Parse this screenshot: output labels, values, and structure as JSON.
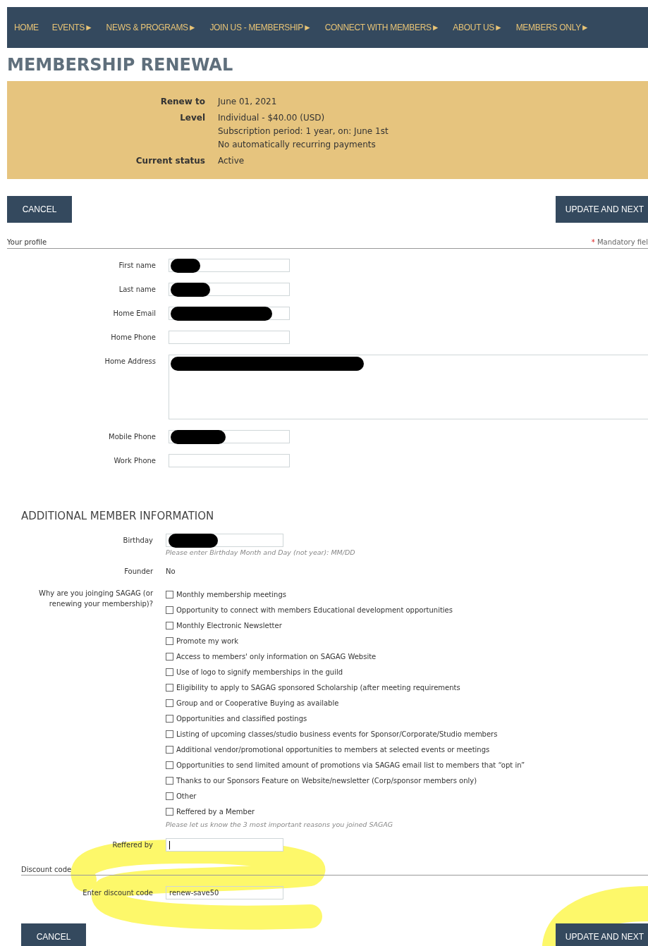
{
  "nav": {
    "items": [
      {
        "label": "HOME"
      },
      {
        "label": "EVENTS",
        "arrow": "►"
      },
      {
        "label": "NEWS & PROGRAMS",
        "arrow": "►"
      },
      {
        "label": "JOIN US - MEMBERSHIP",
        "arrow": "►"
      },
      {
        "label": "CONNECT WITH MEMBERS",
        "arrow": "►"
      },
      {
        "label": "ABOUT US",
        "arrow": "►"
      },
      {
        "label": "MEMBERS ONLY",
        "arrow": "►"
      }
    ]
  },
  "title": "MEMBERSHIP RENEWAL",
  "summary": [
    {
      "label": "Renew to",
      "lines": [
        "June 01, 2021"
      ]
    },
    {
      "label": "Level",
      "lines": [
        "Individual - $40.00 (USD)",
        "Subscription period: 1 year, on: June 1st",
        "No automatically recurring payments"
      ]
    },
    {
      "label": "Current status",
      "lines": [
        "Active"
      ]
    }
  ],
  "buttons_top": {
    "cancel": "CANCEL",
    "next": "UPDATE AND NEXT"
  },
  "profile": {
    "heading": "Your profile",
    "mandatory_mark": "*",
    "mandatory": "Mandatory fiel",
    "fields": [
      {
        "label": "First name",
        "kind": "input",
        "redacted": true
      },
      {
        "label": "Last name",
        "kind": "input",
        "redacted": true
      },
      {
        "label": "Home Email",
        "kind": "input",
        "redacted": true
      },
      {
        "label": "Home Phone",
        "kind": "input",
        "redacted": false
      },
      {
        "label": "Home Address",
        "kind": "textarea",
        "redacted": true
      },
      {
        "label": "Mobile Phone",
        "kind": "input",
        "redacted": true
      },
      {
        "label": "Work Phone",
        "kind": "input",
        "redacted": false
      }
    ]
  },
  "additional": {
    "heading": "ADDITIONAL MEMBER INFORMATION",
    "birthday": {
      "label": "Birthday",
      "redacted": true,
      "hint": "Please enter Birthday Month and Day (not year): MM/DD"
    },
    "founder": {
      "label": "Founder",
      "value": "No"
    },
    "reasons": {
      "label": "Why are you joinging SAGAG (or renewing your membership)?",
      "hint": "Please let us know the 3 most important reasons you joined SAGAG",
      "options": [
        {
          "label": "Monthly membership meetings",
          "checked": false
        },
        {
          "label": "Opportunity to connect with members Educational development opportunities",
          "checked": false
        },
        {
          "label": "Monthly Electronic Newsletter",
          "checked": false
        },
        {
          "label": "Promote my work",
          "checked": false
        },
        {
          "label": "Access to members' only information on SAGAG Website",
          "checked": false
        },
        {
          "label": "Use of logo to signify memberships in the guild",
          "checked": false
        },
        {
          "label": "Eligibility to apply to SAGAG sponsored Scholarship (after meeting requirements",
          "checked": false
        },
        {
          "label": "Group and or Cooperative Buying as available",
          "checked": false
        },
        {
          "label": "Opportunities and classified postings",
          "checked": false
        },
        {
          "label": "Listing of upcoming classes/studio business events for Sponsor/Corporate/Studio members",
          "checked": false
        },
        {
          "label": "Additional vendor/promotional opportunities to members at selected events or meetings",
          "checked": false
        },
        {
          "label": "Opportunities to send limited amount of promotions via SAGAG email list to members that “opt in”",
          "checked": false
        },
        {
          "label": "Thanks to our Sponsors Feature on Website/newsletter (Corp/sponsor members only)",
          "checked": false
        },
        {
          "label": "Other",
          "checked": false
        },
        {
          "label": "Reffered by a Member",
          "checked": false
        }
      ]
    },
    "referred_by": {
      "label": "Reffered by"
    }
  },
  "discount": {
    "heading": "Discount code",
    "label": "Enter discount code",
    "value": "renew-save50"
  },
  "buttons_bottom": {
    "cancel": "CANCEL",
    "next": "UPDATE AND NEXT"
  }
}
